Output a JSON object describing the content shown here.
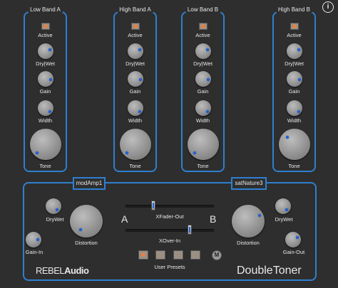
{
  "bands": [
    {
      "title": "Low Band A",
      "active": "Active",
      "drywet": "Dry|Wet",
      "gain": "Gain",
      "width": "Width",
      "tone": "Tone"
    },
    {
      "title": "High Band A",
      "active": "Active",
      "drywet": "Dry|Wet",
      "gain": "Gain",
      "width": "Width",
      "tone": "Tone"
    },
    {
      "title": "Low Band B",
      "active": "Active",
      "drywet": "Dry|Wet",
      "gain": "Gain",
      "width": "Width",
      "tone": "Tone"
    },
    {
      "title": "High Band B",
      "active": "Active",
      "drywet": "Dry|Wet",
      "gain": "Gain",
      "width": "Width",
      "tone": "Tone"
    }
  ],
  "info_icon": "i",
  "amp_a": {
    "name": "modAmp1",
    "drywet": "DryWet",
    "gain_in": "Gain-In",
    "distortion": "Distortion"
  },
  "amp_b": {
    "name": "satNature3",
    "drywet": "DryWet",
    "gain_out": "Gain-Out",
    "distortion": "Distortion"
  },
  "center": {
    "label_a": "A",
    "label_b": "B",
    "xfader_label": "XFader-Out",
    "xover_label": "XOver-In",
    "presets_label": "User Presets",
    "midi_icon": "M"
  },
  "branding": {
    "brand": "REBEL",
    "brand2": "Audio",
    "product": "DoubleToner"
  },
  "colors": {
    "accent": "#2f7fd1",
    "background": "#2e2e2e",
    "led": "#ff7b2a"
  }
}
